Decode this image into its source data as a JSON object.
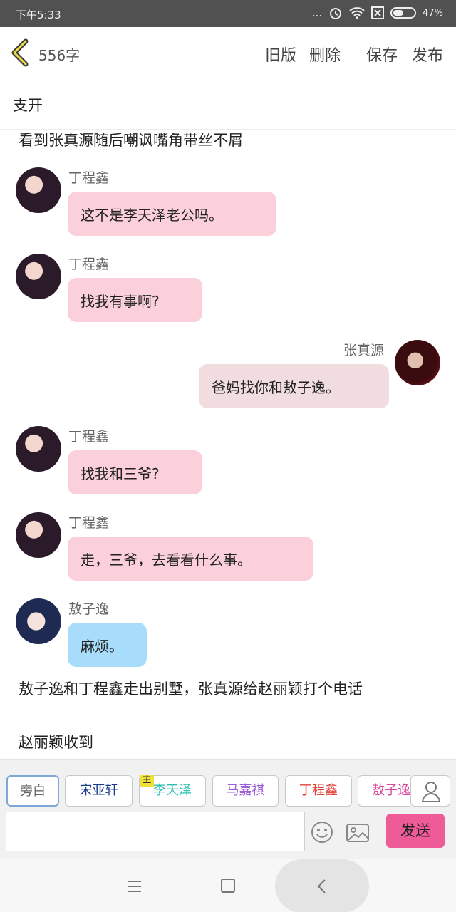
{
  "status": {
    "time": "下午5:33",
    "dots": "...",
    "battery_percent": "47%"
  },
  "header": {
    "word_count": "556字",
    "old_version": "旧版",
    "delete": "删除",
    "save": "保存",
    "publish": "发布"
  },
  "story": {
    "title": "支开",
    "narration_top": "看到张真源随后嘲讽嘴角带丝不屑",
    "messages": [
      {
        "name": "丁程鑫",
        "text": "这不是李天泽老公吗。"
      },
      {
        "name": "丁程鑫",
        "text": "找我有事啊?"
      },
      {
        "name": "张真源",
        "text": "爸妈找你和敖子逸。"
      },
      {
        "name": "丁程鑫",
        "text": "找我和三爷?"
      },
      {
        "name": "丁程鑫",
        "text": "走，三爷，去看看什么事。"
      },
      {
        "name": "敖子逸",
        "text": "麻烦。"
      }
    ],
    "narration_1": "敖子逸和丁程鑫走出别墅，张真源给赵丽颖打个电话",
    "narration_2": "赵丽颖收到"
  },
  "roles": {
    "tabs": [
      {
        "label": "旁白",
        "color": "#666666"
      },
      {
        "label": "宋亚轩",
        "color": "#1a3a8a"
      },
      {
        "label": "李天泽",
        "color": "#2bbfb0"
      },
      {
        "label": "马嘉祺",
        "color": "#9a5fd8"
      },
      {
        "label": "丁程鑫",
        "color": "#e0423a"
      },
      {
        "label": "敖子逸",
        "color": "#d9479a"
      }
    ],
    "main_badge": "主"
  },
  "composer": {
    "input_value": "",
    "send_label": "发送"
  }
}
